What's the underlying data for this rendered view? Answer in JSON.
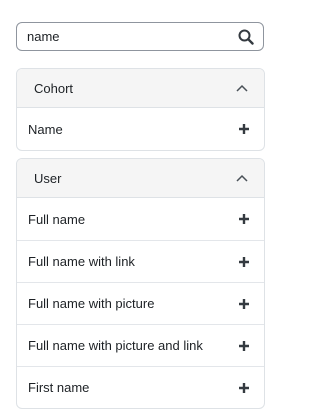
{
  "search": {
    "value": "name"
  },
  "sections": [
    {
      "title": "Cohort",
      "items": [
        "Name"
      ]
    },
    {
      "title": "User",
      "items": [
        "Full name",
        "Full name with link",
        "Full name with picture",
        "Full name with picture and link",
        "First name"
      ]
    }
  ],
  "icons": {
    "search": "search-icon",
    "collapse": "chevron-up-icon",
    "add": "plus-icon"
  },
  "colors": {
    "header_bg": "#f5f5f5",
    "border": "#dee2e6",
    "text": "#1d2125"
  }
}
